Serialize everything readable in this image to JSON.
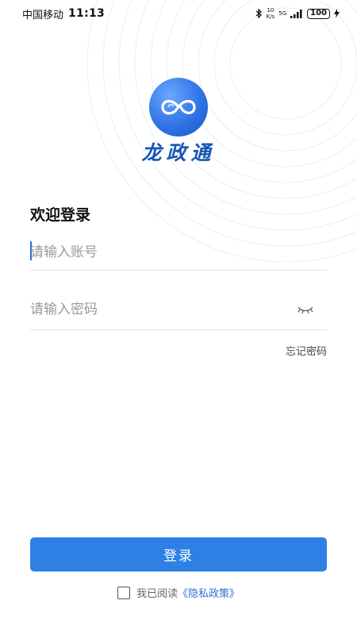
{
  "status_bar": {
    "carrier": "中国移动",
    "time": "11:13",
    "net_speed_value": "10",
    "net_speed_unit": "K/s",
    "network_type": "5G",
    "battery": "100"
  },
  "app": {
    "logo_text": "龙政通"
  },
  "login": {
    "title": "欢迎登录",
    "account_placeholder": "请输入账号",
    "password_placeholder": "请输入密码",
    "forgot_password": "忘记密码",
    "login_button": "登录"
  },
  "agreement": {
    "read_text": "我已阅读",
    "policy_link": "《隐私政策》",
    "checked": false
  },
  "colors": {
    "primary": "#2f80e4",
    "logo_text": "#1556b3",
    "link": "#2f6fd6"
  },
  "icons": [
    "bluetooth-icon",
    "signal-icon",
    "battery-icon",
    "charging-icon",
    "eye-closed-icon",
    "checkbox-icon"
  ]
}
